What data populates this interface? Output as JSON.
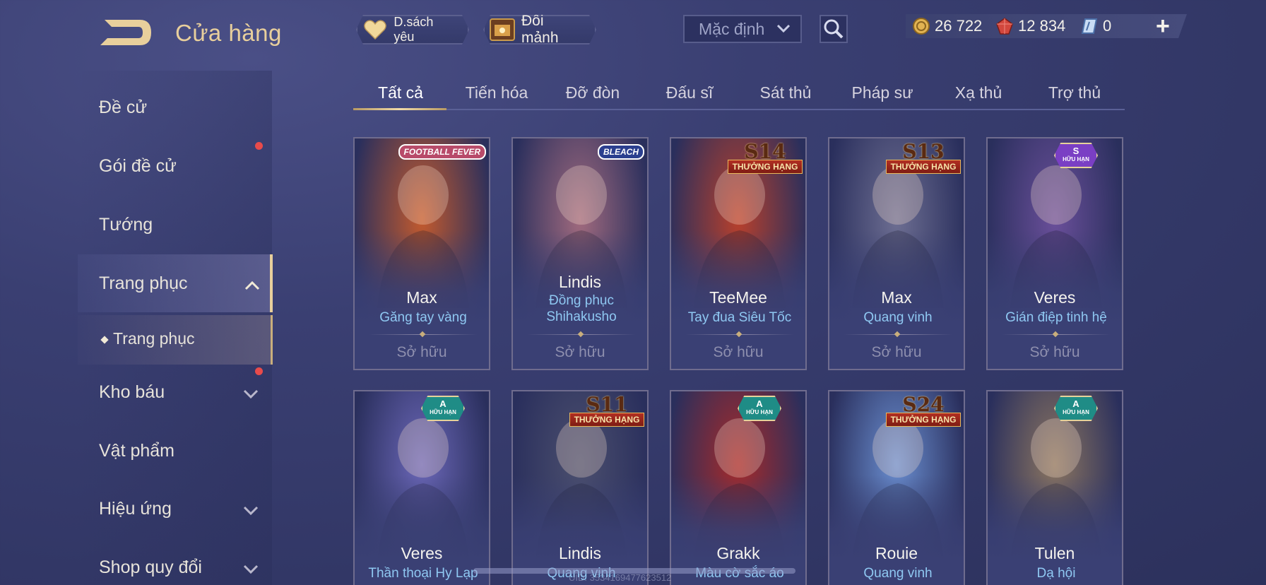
{
  "header": {
    "title": "Cửa hàng",
    "favorites_label": "D.sách yêu",
    "shards_label": "Đổi mảnh",
    "sort_selected": "Mặc định",
    "currencies": {
      "gold": "26 722",
      "ruby": "12 834",
      "voucher": "0"
    }
  },
  "sidebar": {
    "items": [
      {
        "label": "Đề cử"
      },
      {
        "label": "Gói đề cử"
      },
      {
        "label": "Tướng"
      },
      {
        "label": "Trang phục"
      },
      {
        "label": "Trang phục"
      },
      {
        "label": "Kho báu"
      },
      {
        "label": "Vật phẩm"
      },
      {
        "label": "Hiệu ứng"
      },
      {
        "label": "Shop quy đổi"
      }
    ]
  },
  "tabs": [
    {
      "label": "Tất cả"
    },
    {
      "label": "Tiến hóa"
    },
    {
      "label": "Đỡ đòn"
    },
    {
      "label": "Đấu sĩ"
    },
    {
      "label": "Sát thủ"
    },
    {
      "label": "Pháp sư"
    },
    {
      "label": "Xạ thủ"
    },
    {
      "label": "Trợ thủ"
    }
  ],
  "cards": [
    {
      "hero": "Max",
      "skin": "Găng tay vàng",
      "status": "Sở hữu",
      "badge": "FOOTBALL FEVER",
      "color": "#c25a2e"
    },
    {
      "hero": "Lindis",
      "skin": "Đồng phục Shihakusho",
      "status": "Sở hữu",
      "badge": "BLEACH",
      "color": "#a06a7e"
    },
    {
      "hero": "TeeMee",
      "skin": "Tay đua Siêu Tốc",
      "status": "Sở hữu",
      "badge_rank": "S14",
      "badge_label": "THƯỞNG HẠNG",
      "color": "#b8402c"
    },
    {
      "hero": "Max",
      "skin": "Quang vinh",
      "status": "Sở hữu",
      "badge_rank": "S13",
      "badge_label": "THƯỞNG HẠNG",
      "color": "#6d6e92"
    },
    {
      "hero": "Veres",
      "skin": "Gián điệp tinh hệ",
      "status": "Sở hữu",
      "badge_tier": "S",
      "badge_tier_label": "HỮU HẠN",
      "color": "#6a4f9a"
    },
    {
      "hero": "Veres",
      "skin": "Thần thoại Hy Lạp",
      "badge_tier": "A",
      "badge_tier_label": "HỮU HẠN",
      "color": "#6b67b8"
    },
    {
      "hero": "Lindis",
      "skin": "Quang vinh",
      "badge_rank": "S11",
      "badge_label": "THƯỞNG HẠNG",
      "color": "#4b4f6e"
    },
    {
      "hero": "Grakk",
      "skin": "Màu cờ sắc áo",
      "badge_tier": "A",
      "badge_tier_label": "HỮU HẠN",
      "color": "#a62a2a"
    },
    {
      "hero": "Rouie",
      "skin": "Quang vinh",
      "badge_rank": "S24",
      "badge_label": "THƯỞNG HẠNG",
      "color": "#6a8ed0"
    },
    {
      "hero": "Tulen",
      "skin": "Dạ hội",
      "badge_tier": "A",
      "badge_tier_label": "HỮU HẠN",
      "color": "#8b7560"
    }
  ],
  "footer_id": "UID: 3534169477623512",
  "colors": {
    "accent_gold": "#e8cf9c",
    "skin_text": "#8fc8f2",
    "tier_badge": "#1f8c86",
    "tier_badge_purple": "#7a3fc4",
    "notification": "#e84b4b"
  }
}
